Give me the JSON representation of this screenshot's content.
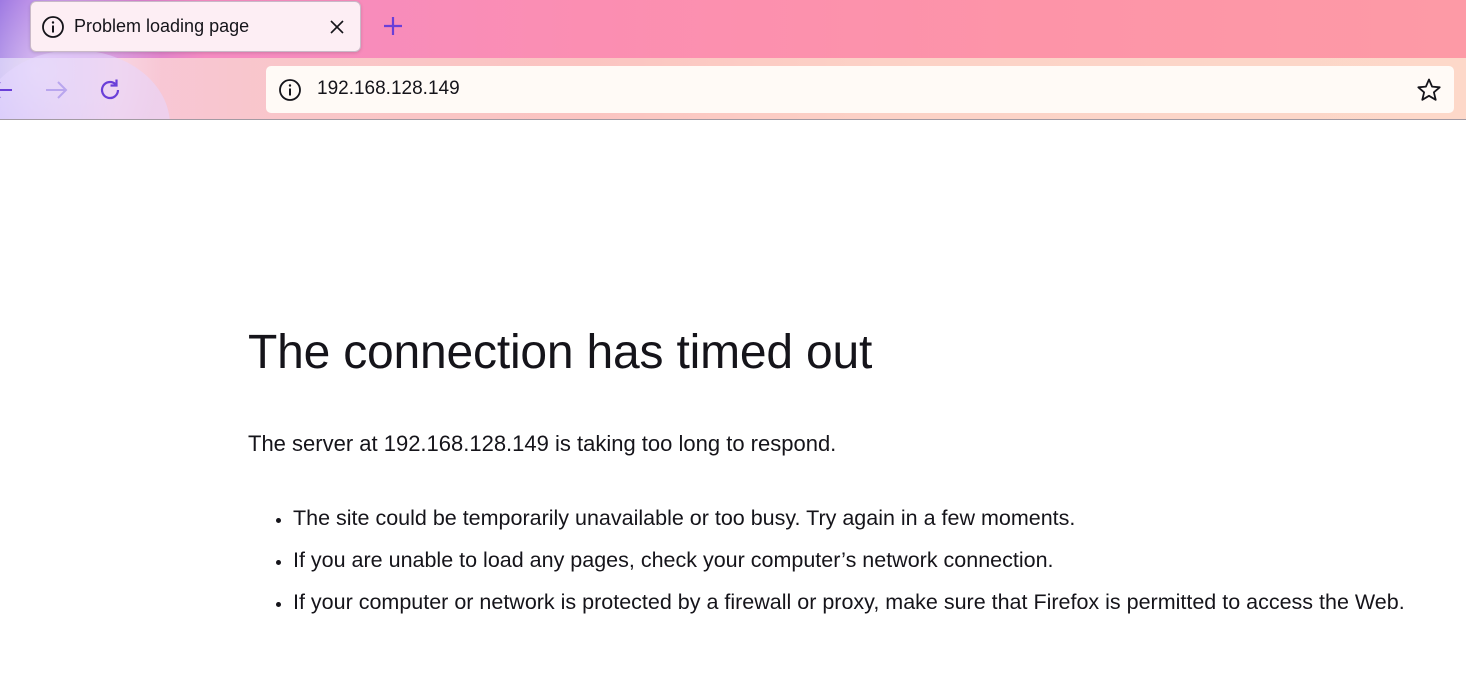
{
  "browser": {
    "tab": {
      "title": "Problem loading page",
      "icon": "info-icon"
    },
    "toolbar": {
      "back_icon": "arrow-left-icon",
      "forward_icon": "arrow-right-icon",
      "reload_icon": "reload-icon",
      "new_tab_icon": "plus-icon",
      "bookmark_icon": "star-icon"
    },
    "urlbar": {
      "value": "192.168.128.149",
      "icon": "info-icon"
    },
    "colors": {
      "accent": "#7542e5",
      "text": "#15141a"
    }
  },
  "error": {
    "title": "The connection has timed out",
    "description": "The server at 192.168.128.149 is taking too long to respond.",
    "suggestions": [
      "The site could be temporarily unavailable or too busy. Try again in a few moments.",
      "If you are unable to load any pages, check your computer’s network connection.",
      "If your computer or network is protected by a firewall or proxy, make sure that Firefox is permitted to access the Web."
    ]
  }
}
